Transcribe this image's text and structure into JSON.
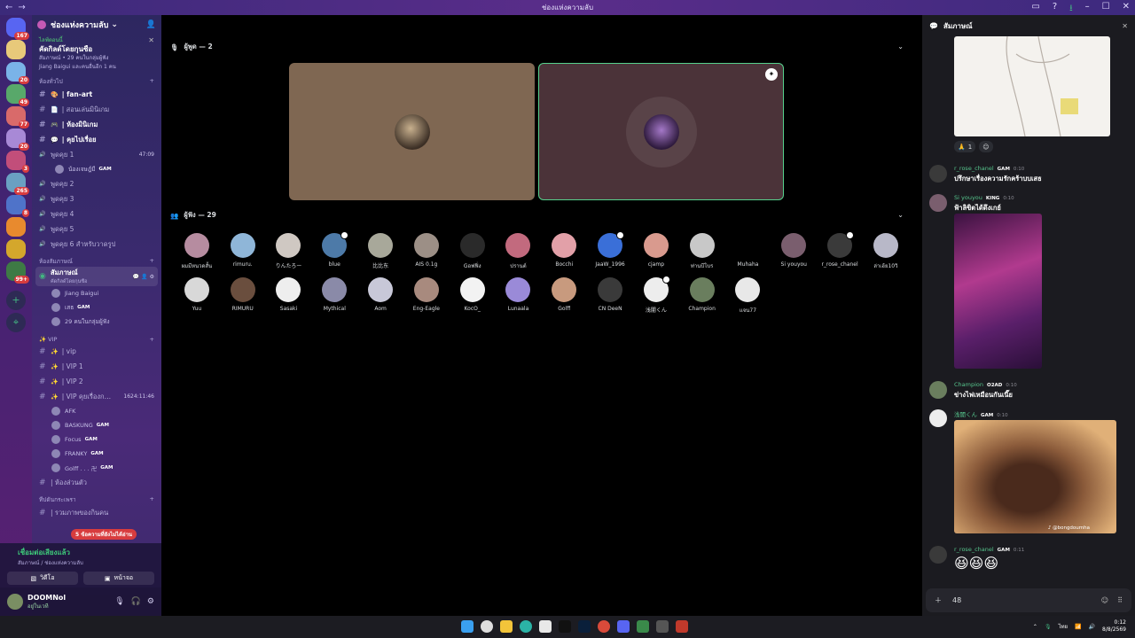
{
  "window": {
    "title": "ช่องแห่งความลับ",
    "nav_back": "←",
    "nav_forward": "→"
  },
  "servers": [
    {
      "name": "Discord Home",
      "color": "#5865f2",
      "badge": "167"
    },
    {
      "name": "server-2",
      "color": "#e8c97a",
      "badge": ""
    },
    {
      "name": "server-3",
      "color": "#7ab3e8",
      "badge": "20"
    },
    {
      "name": "server-4",
      "color": "#58a86a",
      "badge": "49"
    },
    {
      "name": "server-5",
      "color": "#d96a6a",
      "badge": "77"
    },
    {
      "name": "server-6",
      "color": "#a889d6",
      "badge": "20"
    },
    {
      "name": "server-7",
      "color": "#c24e7a",
      "badge": "3"
    },
    {
      "name": "server-8",
      "color": "#6aa0c2",
      "badge": "265"
    },
    {
      "name": "server-9",
      "color": "#4f73c9",
      "badge": "8"
    },
    {
      "name": "server-10",
      "color": "#e88a2e",
      "badge": ""
    },
    {
      "name": "server-11",
      "color": "#d4a72c",
      "badge": ""
    },
    {
      "name": "server-12",
      "color": "#3e7a45",
      "badge": "99+"
    }
  ],
  "guild": {
    "name": "ช่องแห่งความลับ"
  },
  "event": {
    "live": "ไลฟ์ตอนนี้",
    "title": "คัดกิลด์โดยกุนซือ",
    "line1": "สัมภาษณ์ • 29 คนในกลุ่มผู้ฟัง",
    "line2": "Jiang Baigui และคนอื่นอีก 1 คน"
  },
  "categories": {
    "general": "ห้องทั่วไป",
    "interview": "ห้องสัมภาษณ์",
    "vip": "✨ VIP",
    "stage": "ทีปดันกระเพรา"
  },
  "text_channels": [
    {
      "name": "| fan-art",
      "bold": true,
      "icon": "🎨"
    },
    {
      "name": "| สอนเล่นมินิเกม",
      "bold": false,
      "icon": "📄"
    },
    {
      "name": "| ห้องมินิเกม",
      "bold": true,
      "icon": "🎮"
    },
    {
      "name": "| คุยไปเรื่อย",
      "bold": true,
      "icon": "💬"
    }
  ],
  "voice_channels": [
    {
      "name": "พูดคุย 1",
      "time": "47:09"
    },
    {
      "name": "พูดคุย 2",
      "time": ""
    },
    {
      "name": "พูดคุย 3",
      "time": ""
    },
    {
      "name": "พูดคุย 4",
      "time": ""
    },
    {
      "name": "พูดคุย 5",
      "time": ""
    },
    {
      "name": "พูดคุย 6 สำหรับวาดรูป",
      "time": ""
    }
  ],
  "voice1_user": {
    "name": "น้องเจษฎ์มี",
    "tag": "GAM"
  },
  "stage_channel": {
    "name": "สัมภาษณ์",
    "sub": "คัดกิลด์โดยกุนซือ"
  },
  "stage_members": [
    {
      "name": "Jiang Baigui",
      "tag": ""
    },
    {
      "name": "เสธ",
      "tag": "GAM"
    },
    {
      "name": "29 คนในกลุ่มผู้ฟัง",
      "tag": ""
    }
  ],
  "vip_channels": [
    {
      "name": "| vip",
      "time": ""
    },
    {
      "name": "| VIP 1",
      "time": ""
    },
    {
      "name": "| VIP 2",
      "time": ""
    },
    {
      "name": "| VIP คุยเรื่องก…",
      "time": "1624:11:46"
    }
  ],
  "vip_users": [
    {
      "name": "AFK",
      "tag": ""
    },
    {
      "name": "BASKUNG",
      "tag": "GAM"
    },
    {
      "name": "Focus",
      "tag": "GAM"
    },
    {
      "name": "FRANKY",
      "tag": "GAM"
    },
    {
      "name": "Golff . . . 卍",
      "tag": "GAM"
    }
  ],
  "private_channel": "| ห้องส่วนตัว",
  "stage_category_channel": "| รวมภาพของกินคน",
  "new_messages": "5 ข้อความที่ยังไม่ได้อ่าน",
  "voice_status": {
    "title": "เชื่อมต่อเสียงแล้ว",
    "sub": "สัมภาษณ์ / ช่องแห่งความลับ",
    "video": "วิดีโอ",
    "screen": "หน้าจอ"
  },
  "user": {
    "name": "DOOMNol",
    "status": "อยู่ในเวที"
  },
  "stage": {
    "speakers_header": "ผู้พูด — 2",
    "audience_header": "ผู้ฟัง — 29"
  },
  "audience": [
    {
      "name": "ผมมีหนวดสั้น",
      "color": "#b68ca0",
      "stage": false
    },
    {
      "name": "rimuru.",
      "color": "#8fb6d8",
      "stage": false
    },
    {
      "name": "りんたろー",
      "color": "#cfc8c2",
      "stage": false
    },
    {
      "name": "blue",
      "color": "#4d7aa8",
      "stage": true
    },
    {
      "name": "比比东",
      "color": "#a8a89a",
      "stage": false
    },
    {
      "name": "AIS 0.1g",
      "color": "#9c8f86",
      "stage": false
    },
    {
      "name": "Gอฟฟิ่ง",
      "color": "#2a2a2a",
      "stage": false
    },
    {
      "name": "ปรานต์",
      "color": "#c26a7e",
      "stage": false
    },
    {
      "name": "Bocchi",
      "color": "#e2a0a8",
      "stage": false
    },
    {
      "name": "JaaW_1996",
      "color": "#3a6fd8",
      "stage": true
    },
    {
      "name": "cjamp",
      "color": "#d99a8e",
      "stage": false
    },
    {
      "name": "ท่านบีโบร",
      "color": "#c8c8c8",
      "stage": false
    },
    {
      "name": "Muhaha",
      "color": "#000000",
      "stage": false
    },
    {
      "name": "Si youyou",
      "color": "#7a5e6e",
      "stage": false
    },
    {
      "name": "r_rose_chanel",
      "color": "#3a3a3a",
      "stage": true
    },
    {
      "name": "ล่าเฮ้ย10วิ",
      "color": "#b8b8c8",
      "stage": false
    },
    {
      "name": "Yuu",
      "color": "#d8d8d8",
      "stage": false
    },
    {
      "name": "RIMURU",
      "color": "#6a4e3e",
      "stage": false
    },
    {
      "name": "Sasaki",
      "color": "#eeeeee",
      "stage": false
    },
    {
      "name": "Mythical",
      "color": "#8a8aa8",
      "stage": false
    },
    {
      "name": "Aom",
      "color": "#c8c8d8",
      "stage": false
    },
    {
      "name": "Eng-Eagle",
      "color": "#a88a7e",
      "stage": false
    },
    {
      "name": "KocO_",
      "color": "#f2f2f2",
      "stage": false
    },
    {
      "name": "Lunaala",
      "color": "#9a8ad8",
      "stage": false
    },
    {
      "name": "Golff",
      "color": "#c89a7e",
      "stage": false
    },
    {
      "name": "CN DeeN",
      "color": "#3a3a3a",
      "stage": false
    },
    {
      "name": "浅闇くん",
      "color": "#ededed",
      "stage": true
    },
    {
      "name": "Champion",
      "color": "#6a7e5e",
      "stage": false
    },
    {
      "name": "แจน77",
      "color": "#e8e8e8",
      "stage": false
    }
  ],
  "chat": {
    "title": "สัมภาษณ์",
    "reaction_count": "1",
    "messages": [
      {
        "author": "r_rose_chanel",
        "tag": "GAM",
        "time": "0:10",
        "text": "ปรึกษาเรื่องความรักคร้าบบเสธ",
        "avatar": "#3a3a3a"
      },
      {
        "author": "Si youyou",
        "tag": "KING",
        "time": "0:10",
        "text": "ฟ้าลิขิตได้ดึงเกย์",
        "avatar": "#7a5e6e"
      },
      {
        "author": "Champion",
        "tag": "O2AD",
        "time": "0:10",
        "text": "ข่างไฟเหมือนกันเนี๊ย",
        "avatar": "#6a7e5e"
      },
      {
        "author": "浅闇くん",
        "tag": "GAM",
        "time": "0:10",
        "text": "",
        "avatar": "#ededed"
      },
      {
        "author": "r_rose_chanel",
        "tag": "GAM",
        "time": "0:11",
        "text": "😆😆😆",
        "avatar": "#3a3a3a"
      }
    ],
    "image_caption": "♪ @bongdoumha",
    "composer_value": "48"
  },
  "taskbar": {
    "time": "0:12",
    "date": "8/8/2569",
    "lang": "ไทย"
  }
}
